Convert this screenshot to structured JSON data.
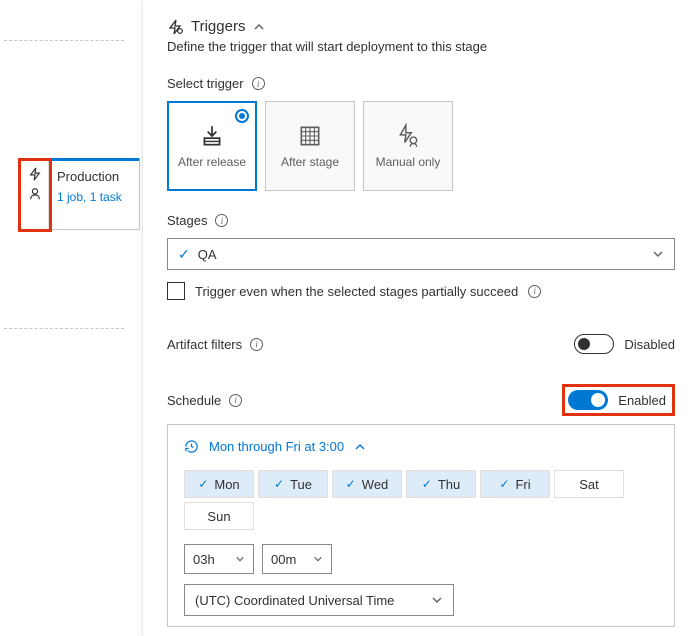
{
  "stage": {
    "name": "Production",
    "sub": "1 job, 1 task"
  },
  "panel": {
    "title": "Triggers",
    "desc": "Define the trigger that will start deployment to this stage"
  },
  "selectTrigger": {
    "label": "Select trigger",
    "options": {
      "after_release": "After release",
      "after_stage": "After stage",
      "manual_only": "Manual only"
    }
  },
  "stages": {
    "label": "Stages",
    "value": "QA",
    "partial": "Trigger even when the selected stages partially succeed"
  },
  "artifact": {
    "label": "Artifact filters",
    "state": "Disabled"
  },
  "schedule": {
    "label": "Schedule",
    "state": "Enabled",
    "summary": "Mon through Fri at 3:00",
    "days": {
      "mon": "Mon",
      "tue": "Tue",
      "wed": "Wed",
      "thu": "Thu",
      "fri": "Fri",
      "sat": "Sat",
      "sun": "Sun"
    },
    "hour": "03h",
    "minute": "00m",
    "tz": "(UTC) Coordinated Universal Time"
  }
}
